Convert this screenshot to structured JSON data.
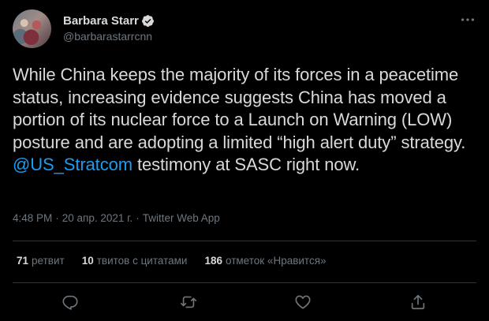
{
  "author": {
    "display_name": "Barbara Starr",
    "handle": "@barbarastarrcnn"
  },
  "tweet": {
    "text_before_mention": "While China keeps the majority of its forces in a peacetime status, increasing evidence suggests China has moved a portion of its nuclear force to a Launch on Warning (LOW) posture and are adopting a limited “high alert duty” strategy. ",
    "mention": "@US_Stratcom",
    "text_after_mention": " testimony at SASC right now."
  },
  "meta": {
    "time": "4:48 PM",
    "date": "20 апр. 2021 г.",
    "source": "Twitter Web App",
    "separator": "·"
  },
  "stats": {
    "retweets_count": "71",
    "retweets_label": "ретвит",
    "quotes_count": "10",
    "quotes_label": "твитов с цитатами",
    "likes_count": "186",
    "likes_label": "отметок «Нравится»"
  },
  "colors": {
    "background": "#000000",
    "text": "#d9d9d9",
    "secondary": "#6e767d",
    "accent": "#1d9bf0",
    "divider": "#2f3336"
  },
  "icons": {
    "verified": "verified-badge-icon",
    "more": "more-options-icon",
    "reply": "reply-icon",
    "retweet": "retweet-icon",
    "like": "heart-icon",
    "share": "share-icon"
  }
}
